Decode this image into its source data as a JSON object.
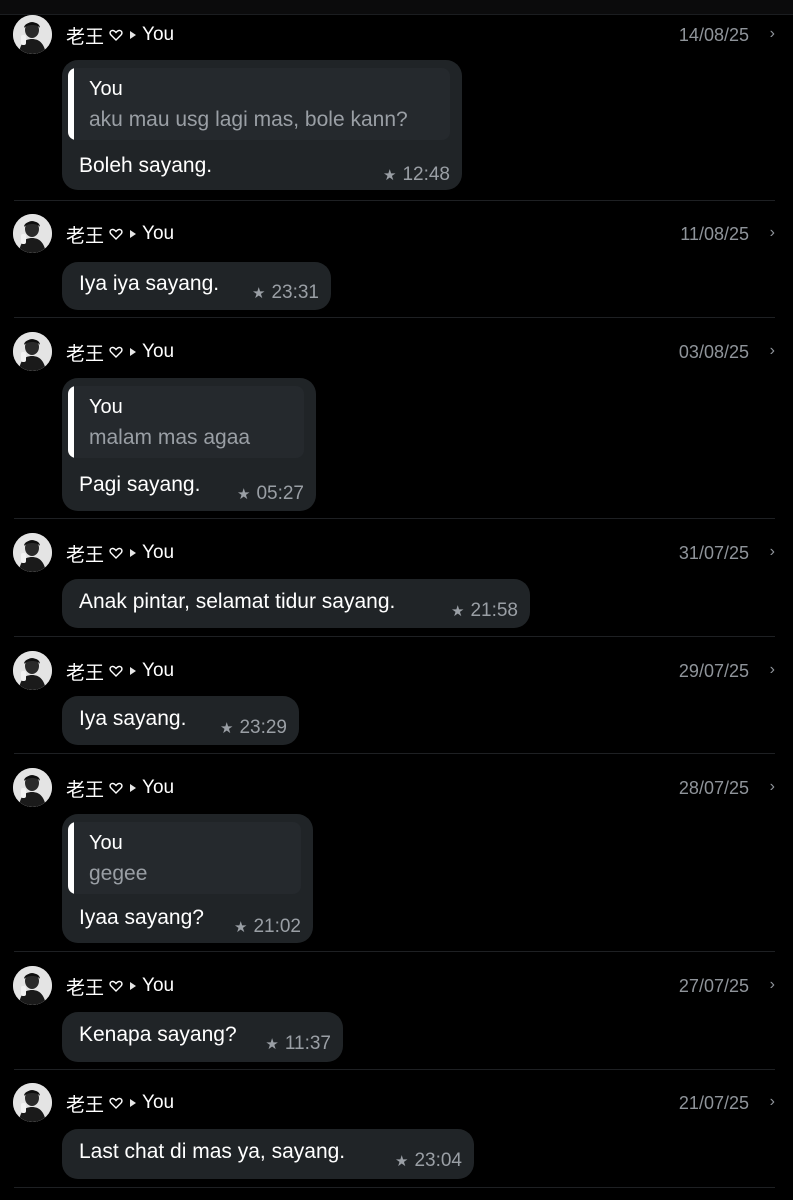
{
  "entries": [
    {
      "sender": "老王",
      "recipient": "You",
      "date": "14/08/25",
      "quote_name": "You",
      "quote_text": "aku mau usg lagi mas, bole kann?",
      "message": "Boleh sayang.",
      "time": "12:48"
    },
    {
      "sender": "老王",
      "recipient": "You",
      "date": "11/08/25",
      "quote_name": "",
      "quote_text": "",
      "message": "Iya iya sayang.",
      "time": "23:31"
    },
    {
      "sender": "老王",
      "recipient": "You",
      "date": "03/08/25",
      "quote_name": "You",
      "quote_text": "malam mas agaa",
      "message": "Pagi sayang.",
      "time": "05:27"
    },
    {
      "sender": "老王",
      "recipient": "You",
      "date": "31/07/25",
      "quote_name": "",
      "quote_text": "",
      "message": "Anak pintar, selamat tidur sayang.",
      "time": "21:58"
    },
    {
      "sender": "老王",
      "recipient": "You",
      "date": "29/07/25",
      "quote_name": "",
      "quote_text": "",
      "message": "Iya sayang.",
      "time": "23:29"
    },
    {
      "sender": "老王",
      "recipient": "You",
      "date": "28/07/25",
      "quote_name": "You",
      "quote_text": "gegee",
      "message": "Iyaa sayang?",
      "time": "21:02"
    },
    {
      "sender": "老王",
      "recipient": "You",
      "date": "27/07/25",
      "quote_name": "",
      "quote_text": "",
      "message": "Kenapa sayang?",
      "time": "11:37"
    },
    {
      "sender": "老王",
      "recipient": "You",
      "date": "21/07/25",
      "quote_name": "",
      "quote_text": "",
      "message": "Last chat di mas ya, sayang.",
      "time": "23:04"
    }
  ],
  "icons": {
    "heart": "heart-outline-icon",
    "arrow": "forward-arrow-icon",
    "star": "star-icon",
    "chevron": "chevron-right-icon"
  },
  "colors": {
    "background": "#000000",
    "bubble": "#202427",
    "quote": "#25292d",
    "quote_bar": "#ffffff",
    "muted": "#9a9fa5",
    "divider": "#1e2023"
  }
}
